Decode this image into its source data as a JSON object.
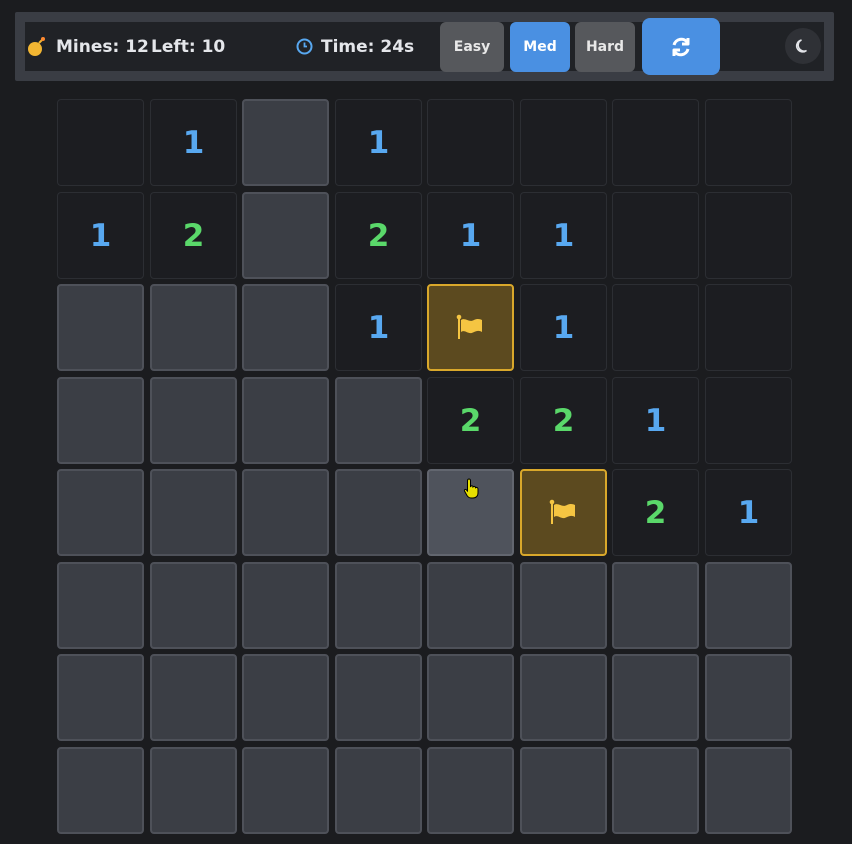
{
  "header": {
    "mines_text": "Mines: 12",
    "left_text": "Left: 10",
    "time_text": "Time: 24s",
    "bomb_icon": "bomb-icon",
    "clock_icon": "clock-icon"
  },
  "difficulty": {
    "options": [
      "Easy",
      "Med",
      "Hard"
    ],
    "selected": "Med"
  },
  "actions": {
    "reset_icon": "refresh-icon",
    "theme_icon": "moon-icon"
  },
  "colors": {
    "accent": "#4a90e2",
    "flag": "#d9a82b",
    "number_1": "#58a8f0",
    "number_2": "#5ad86a"
  },
  "board": {
    "rows": 8,
    "cols": 8,
    "hovered_cell": "row 5, col 5",
    "cells": [
      [
        "",
        "1",
        "#",
        "1",
        "",
        "",
        "",
        ""
      ],
      [
        "1",
        "2",
        "#",
        "2",
        "1",
        "1",
        "",
        ""
      ],
      [
        "#",
        "#",
        "#",
        "1",
        "F",
        "1",
        "",
        ""
      ],
      [
        "#",
        "#",
        "#",
        "#",
        "2",
        "2",
        "1",
        ""
      ],
      [
        "#",
        "#",
        "#",
        "#",
        "#",
        "F",
        "2",
        "1"
      ],
      [
        "#",
        "#",
        "#",
        "#",
        "#",
        "#",
        "#",
        "#"
      ],
      [
        "#",
        "#",
        "#",
        "#",
        "#",
        "#",
        "#",
        "#"
      ],
      [
        "#",
        "#",
        "#",
        "#",
        "#",
        "#",
        "#",
        "#"
      ]
    ]
  }
}
